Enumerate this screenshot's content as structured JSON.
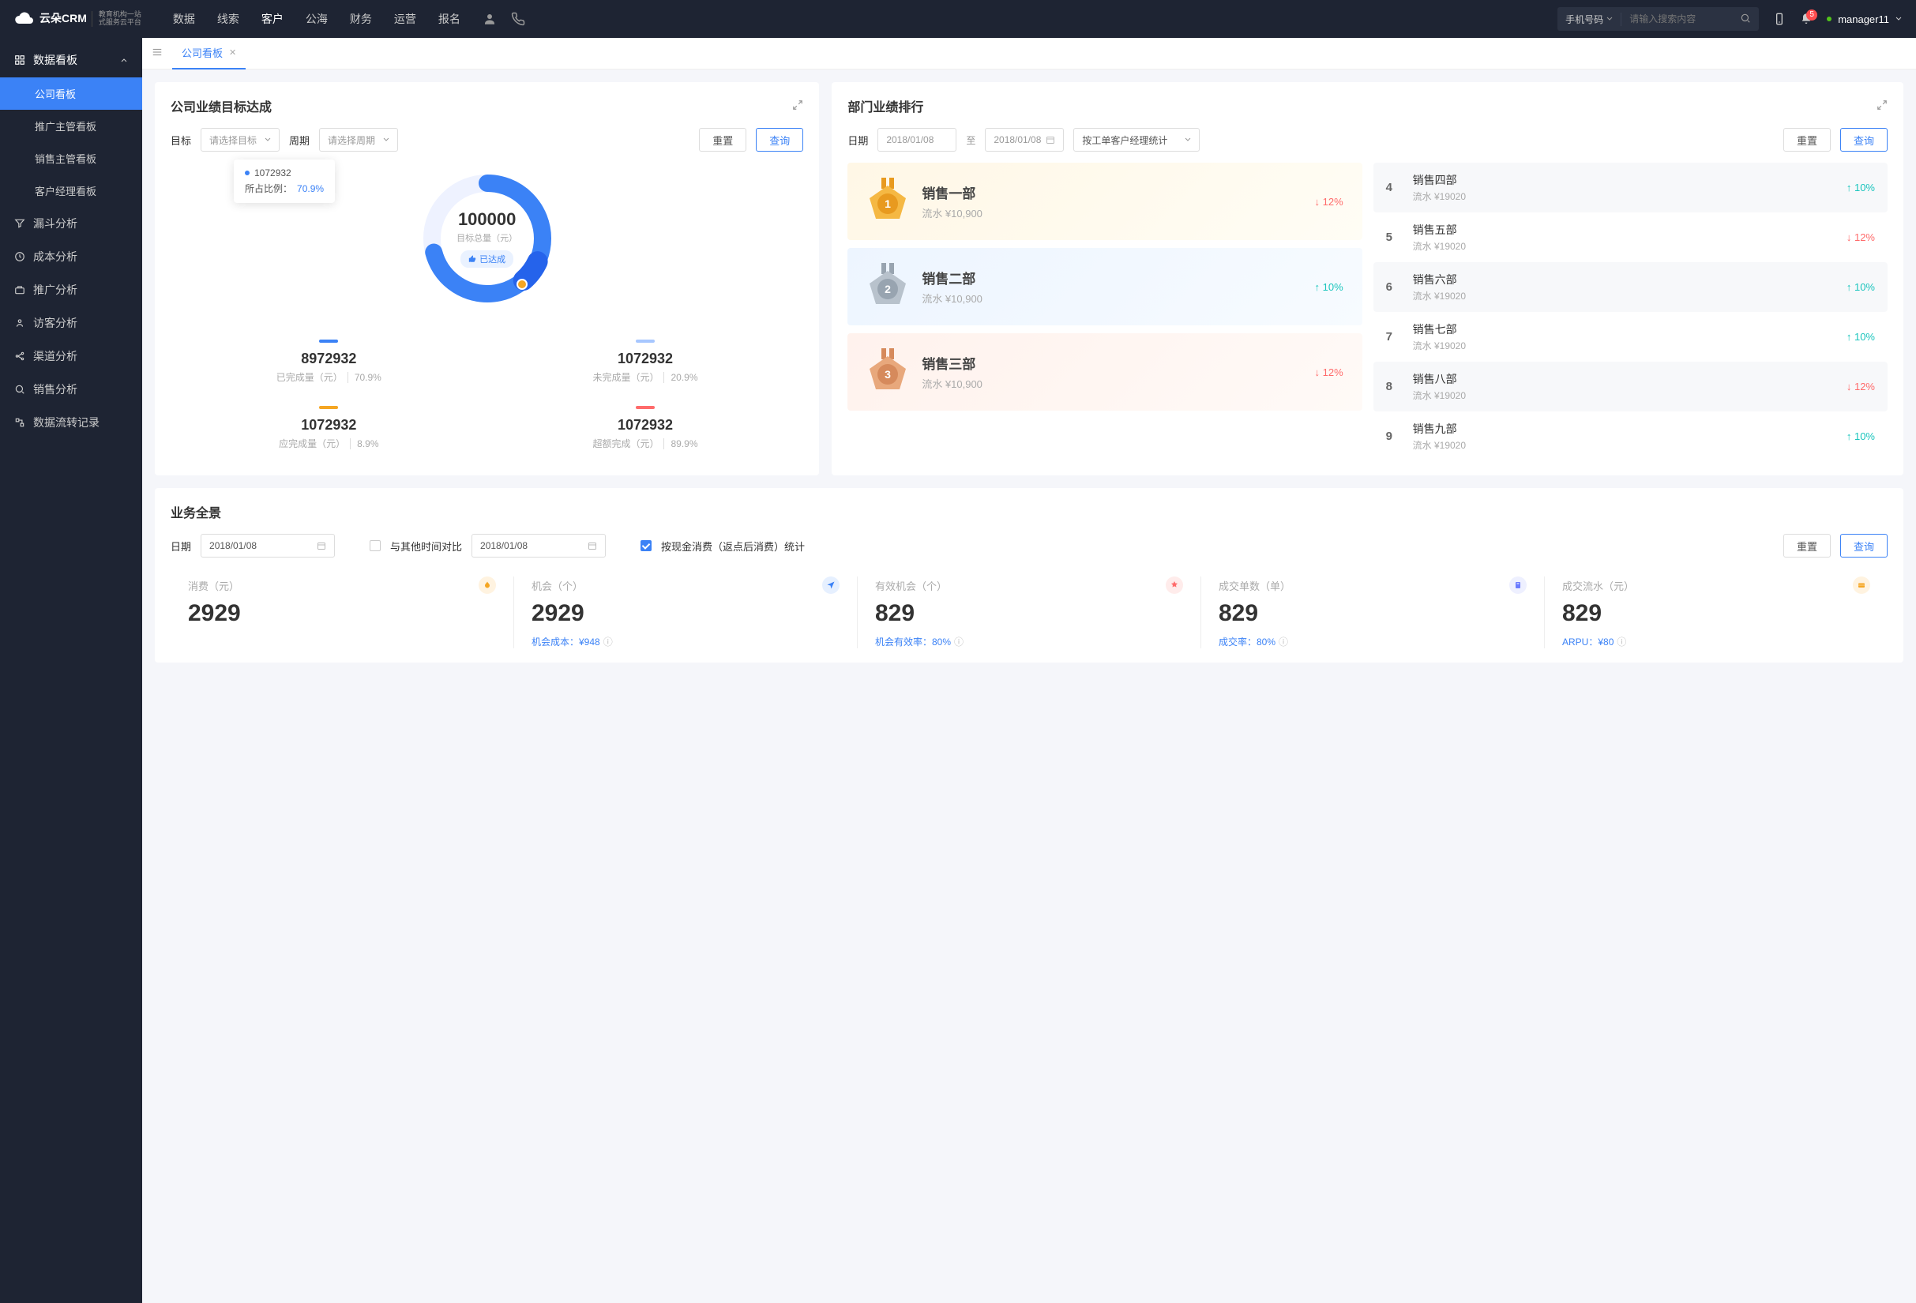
{
  "brand": {
    "name": "云朵CRM",
    "sub1": "教育机构一站",
    "sub2": "式服务云平台"
  },
  "nav": {
    "items": [
      "数据",
      "线索",
      "客户",
      "公海",
      "财务",
      "运营",
      "报名"
    ],
    "active": 2
  },
  "search": {
    "type": "手机号码",
    "placeholder": "请输入搜索内容"
  },
  "notif_count": "5",
  "user": "manager11",
  "sidebar": {
    "board_group": {
      "title": "数据看板",
      "items": [
        "公司看板",
        "推广主管看板",
        "销售主管看板",
        "客户经理看板"
      ],
      "active": 0
    },
    "others": [
      {
        "icon": "funnel",
        "label": "漏斗分析"
      },
      {
        "icon": "cost",
        "label": "成本分析"
      },
      {
        "icon": "promo",
        "label": "推广分析"
      },
      {
        "icon": "visitor",
        "label": "访客分析"
      },
      {
        "icon": "channel",
        "label": "渠道分析"
      },
      {
        "icon": "sales",
        "label": "销售分析"
      },
      {
        "icon": "flow",
        "label": "数据流转记录"
      }
    ]
  },
  "tab": {
    "label": "公司看板"
  },
  "target_card": {
    "title": "公司业绩目标达成",
    "filter_target": "目标",
    "target_ph": "请选择目标",
    "filter_period": "周期",
    "period_ph": "请选择周期",
    "btn_reset": "重置",
    "btn_query": "查询",
    "tooltip_val": "1072932",
    "tooltip_pct_lbl": "所占比例：",
    "tooltip_pct": "70.9%",
    "center_val": "100000",
    "center_lbl": "目标总量（元）",
    "center_badge": "已达成",
    "stats": [
      {
        "color": "#3b82f6",
        "val": "8972932",
        "lbl": "已完成量（元）",
        "pct": "70.9%"
      },
      {
        "color": "#a7c7ff",
        "val": "1072932",
        "lbl": "未完成量（元）",
        "pct": "20.9%"
      },
      {
        "color": "#f5a623",
        "val": "1072932",
        "lbl": "应完成量（元）",
        "pct": "8.9%"
      },
      {
        "color": "#ff6b6b",
        "val": "1072932",
        "lbl": "超额完成（元）",
        "pct": "89.9%"
      }
    ]
  },
  "rank_card": {
    "title": "部门业绩排行",
    "filter_date": "日期",
    "date1": "2018/01/08",
    "date_sep": "至",
    "date2": "2018/01/08",
    "stat_by": "按工单客户经理统计",
    "btn_reset": "重置",
    "btn_query": "查询",
    "top3": [
      {
        "name": "销售一部",
        "sub": "流水 ¥10,900",
        "delta": "12%",
        "dir": "down"
      },
      {
        "name": "销售二部",
        "sub": "流水 ¥10,900",
        "delta": "10%",
        "dir": "up"
      },
      {
        "name": "销售三部",
        "sub": "流水 ¥10,900",
        "delta": "12%",
        "dir": "down"
      }
    ],
    "rest": [
      {
        "n": "4",
        "name": "销售四部",
        "sub": "流水 ¥19020",
        "delta": "10%",
        "dir": "up"
      },
      {
        "n": "5",
        "name": "销售五部",
        "sub": "流水 ¥19020",
        "delta": "12%",
        "dir": "down"
      },
      {
        "n": "6",
        "name": "销售六部",
        "sub": "流水 ¥19020",
        "delta": "10%",
        "dir": "up"
      },
      {
        "n": "7",
        "name": "销售七部",
        "sub": "流水 ¥19020",
        "delta": "10%",
        "dir": "up"
      },
      {
        "n": "8",
        "name": "销售八部",
        "sub": "流水 ¥19020",
        "delta": "12%",
        "dir": "down"
      },
      {
        "n": "9",
        "name": "销售九部",
        "sub": "流水 ¥19020",
        "delta": "10%",
        "dir": "up"
      }
    ]
  },
  "overview_card": {
    "title": "业务全景",
    "filter_date": "日期",
    "date1": "2018/01/08",
    "compare_lbl": "与其他时间对比",
    "date2": "2018/01/08",
    "stat_lbl": "按现金消费（返点后消费）统计",
    "btn_reset": "重置",
    "btn_query": "查询",
    "metrics": [
      {
        "lbl": "消费（元）",
        "val": "2929",
        "foot": "",
        "icon_bg": "#fff3e0",
        "icon_fg": "#f5a623"
      },
      {
        "lbl": "机会（个）",
        "val": "2929",
        "foot_lbl": "机会成本：",
        "foot_val": "¥948",
        "icon_bg": "#e6f0ff",
        "icon_fg": "#3b82f6"
      },
      {
        "lbl": "有效机会（个）",
        "val": "829",
        "foot_lbl": "机会有效率：",
        "foot_val": "80%",
        "icon_bg": "#ffeceb",
        "icon_fg": "#ff6b6b"
      },
      {
        "lbl": "成交单数（单）",
        "val": "829",
        "foot_lbl": "成交率：",
        "foot_val": "80%",
        "icon_bg": "#eef0ff",
        "icon_fg": "#6b7cff"
      },
      {
        "lbl": "成交流水（元）",
        "val": "829",
        "foot_lbl": "ARPU：",
        "foot_val": "¥80",
        "icon_bg": "#fff3e0",
        "icon_fg": "#f5a623"
      }
    ]
  },
  "chart_data": {
    "type": "pie",
    "title": "公司业绩目标达成",
    "total_label": "目标总量（元）",
    "total": 100000,
    "series": [
      {
        "name": "已完成量（元）",
        "value": 8972932,
        "pct": 70.9,
        "color": "#3b82f6"
      },
      {
        "name": "未完成量（元）",
        "value": 1072932,
        "pct": 20.9,
        "color": "#a7c7ff"
      },
      {
        "name": "应完成量（元）",
        "value": 1072932,
        "pct": 8.9,
        "color": "#f5a623"
      },
      {
        "name": "超额完成（元）",
        "value": 1072932,
        "pct": 89.9,
        "color": "#ff6b6b"
      }
    ],
    "tooltip": {
      "value": 1072932,
      "pct": 70.9
    }
  }
}
